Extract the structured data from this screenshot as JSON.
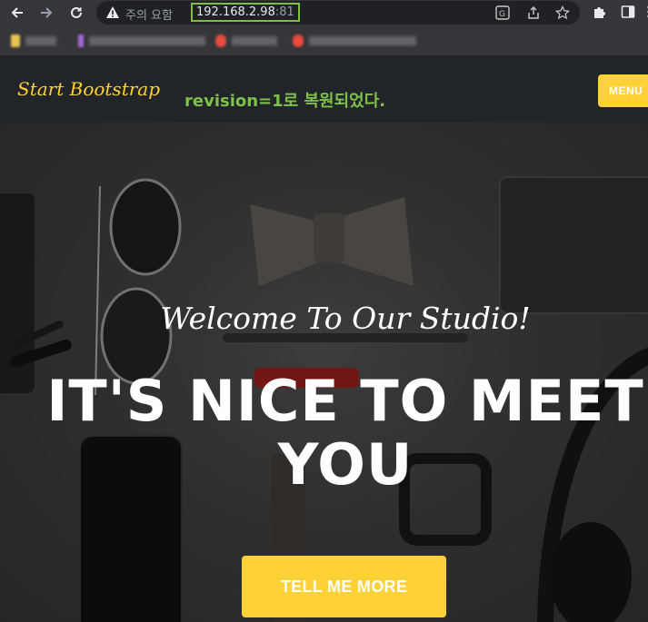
{
  "browser": {
    "security_warning": "주의 요함",
    "url_host": "192.168.2.98",
    "url_port": ":81",
    "icons": [
      "back-arrow-icon",
      "forward-arrow-icon",
      "reload-icon",
      "warning-icon",
      "translate-icon",
      "share-icon",
      "bookmark-star-icon",
      "extensions-icon",
      "side-panel-icon",
      "more-vert-icon"
    ]
  },
  "bookmarks": {
    "items": [
      {
        "fav_color": "#e7c34d"
      },
      {
        "fav_color": "#a46cd6"
      },
      {
        "fav_color": "#e74c3c"
      },
      {
        "fav_color": "#e74c3c"
      }
    ]
  },
  "navbar": {
    "brand": "Start Bootstrap",
    "revision_note": "revision=1로 복원되었다.",
    "menu_label": "MENU"
  },
  "hero": {
    "subheading": "Welcome To Our Studio!",
    "heading_line1": "IT'S NICE TO MEET",
    "heading_line2": "YOU",
    "cta_label": "TELL ME MORE"
  },
  "colors": {
    "accent": "#fed136",
    "navbar_bg": "#212529",
    "revision_note": "#7ec04a",
    "url_highlight": "#7fbf3f"
  }
}
